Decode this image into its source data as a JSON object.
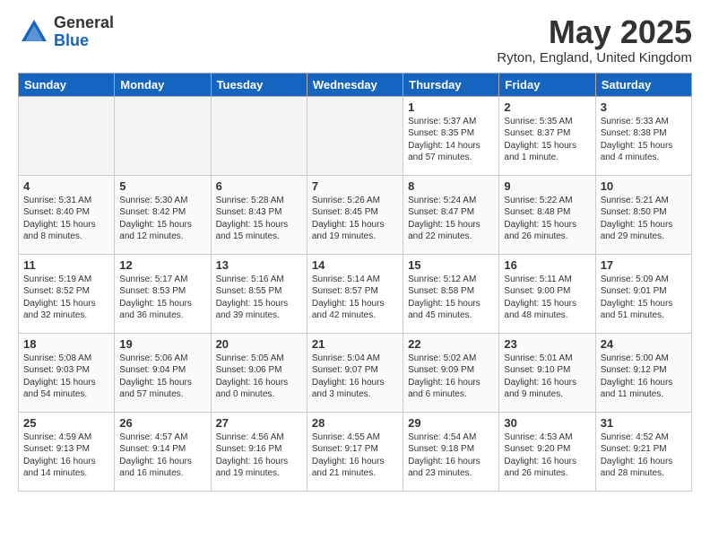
{
  "header": {
    "logo_general": "General",
    "logo_blue": "Blue",
    "month_title": "May 2025",
    "location": "Ryton, England, United Kingdom"
  },
  "weekdays": [
    "Sunday",
    "Monday",
    "Tuesday",
    "Wednesday",
    "Thursday",
    "Friday",
    "Saturday"
  ],
  "weeks": [
    [
      {
        "day": "",
        "info": ""
      },
      {
        "day": "",
        "info": ""
      },
      {
        "day": "",
        "info": ""
      },
      {
        "day": "",
        "info": ""
      },
      {
        "day": "1",
        "info": "Sunrise: 5:37 AM\nSunset: 8:35 PM\nDaylight: 14 hours\nand 57 minutes."
      },
      {
        "day": "2",
        "info": "Sunrise: 5:35 AM\nSunset: 8:37 PM\nDaylight: 15 hours\nand 1 minute."
      },
      {
        "day": "3",
        "info": "Sunrise: 5:33 AM\nSunset: 8:38 PM\nDaylight: 15 hours\nand 4 minutes."
      }
    ],
    [
      {
        "day": "4",
        "info": "Sunrise: 5:31 AM\nSunset: 8:40 PM\nDaylight: 15 hours\nand 8 minutes."
      },
      {
        "day": "5",
        "info": "Sunrise: 5:30 AM\nSunset: 8:42 PM\nDaylight: 15 hours\nand 12 minutes."
      },
      {
        "day": "6",
        "info": "Sunrise: 5:28 AM\nSunset: 8:43 PM\nDaylight: 15 hours\nand 15 minutes."
      },
      {
        "day": "7",
        "info": "Sunrise: 5:26 AM\nSunset: 8:45 PM\nDaylight: 15 hours\nand 19 minutes."
      },
      {
        "day": "8",
        "info": "Sunrise: 5:24 AM\nSunset: 8:47 PM\nDaylight: 15 hours\nand 22 minutes."
      },
      {
        "day": "9",
        "info": "Sunrise: 5:22 AM\nSunset: 8:48 PM\nDaylight: 15 hours\nand 26 minutes."
      },
      {
        "day": "10",
        "info": "Sunrise: 5:21 AM\nSunset: 8:50 PM\nDaylight: 15 hours\nand 29 minutes."
      }
    ],
    [
      {
        "day": "11",
        "info": "Sunrise: 5:19 AM\nSunset: 8:52 PM\nDaylight: 15 hours\nand 32 minutes."
      },
      {
        "day": "12",
        "info": "Sunrise: 5:17 AM\nSunset: 8:53 PM\nDaylight: 15 hours\nand 36 minutes."
      },
      {
        "day": "13",
        "info": "Sunrise: 5:16 AM\nSunset: 8:55 PM\nDaylight: 15 hours\nand 39 minutes."
      },
      {
        "day": "14",
        "info": "Sunrise: 5:14 AM\nSunset: 8:57 PM\nDaylight: 15 hours\nand 42 minutes."
      },
      {
        "day": "15",
        "info": "Sunrise: 5:12 AM\nSunset: 8:58 PM\nDaylight: 15 hours\nand 45 minutes."
      },
      {
        "day": "16",
        "info": "Sunrise: 5:11 AM\nSunset: 9:00 PM\nDaylight: 15 hours\nand 48 minutes."
      },
      {
        "day": "17",
        "info": "Sunrise: 5:09 AM\nSunset: 9:01 PM\nDaylight: 15 hours\nand 51 minutes."
      }
    ],
    [
      {
        "day": "18",
        "info": "Sunrise: 5:08 AM\nSunset: 9:03 PM\nDaylight: 15 hours\nand 54 minutes."
      },
      {
        "day": "19",
        "info": "Sunrise: 5:06 AM\nSunset: 9:04 PM\nDaylight: 15 hours\nand 57 minutes."
      },
      {
        "day": "20",
        "info": "Sunrise: 5:05 AM\nSunset: 9:06 PM\nDaylight: 16 hours\nand 0 minutes."
      },
      {
        "day": "21",
        "info": "Sunrise: 5:04 AM\nSunset: 9:07 PM\nDaylight: 16 hours\nand 3 minutes."
      },
      {
        "day": "22",
        "info": "Sunrise: 5:02 AM\nSunset: 9:09 PM\nDaylight: 16 hours\nand 6 minutes."
      },
      {
        "day": "23",
        "info": "Sunrise: 5:01 AM\nSunset: 9:10 PM\nDaylight: 16 hours\nand 9 minutes."
      },
      {
        "day": "24",
        "info": "Sunrise: 5:00 AM\nSunset: 9:12 PM\nDaylight: 16 hours\nand 11 minutes."
      }
    ],
    [
      {
        "day": "25",
        "info": "Sunrise: 4:59 AM\nSunset: 9:13 PM\nDaylight: 16 hours\nand 14 minutes."
      },
      {
        "day": "26",
        "info": "Sunrise: 4:57 AM\nSunset: 9:14 PM\nDaylight: 16 hours\nand 16 minutes."
      },
      {
        "day": "27",
        "info": "Sunrise: 4:56 AM\nSunset: 9:16 PM\nDaylight: 16 hours\nand 19 minutes."
      },
      {
        "day": "28",
        "info": "Sunrise: 4:55 AM\nSunset: 9:17 PM\nDaylight: 16 hours\nand 21 minutes."
      },
      {
        "day": "29",
        "info": "Sunrise: 4:54 AM\nSunset: 9:18 PM\nDaylight: 16 hours\nand 23 minutes."
      },
      {
        "day": "30",
        "info": "Sunrise: 4:53 AM\nSunset: 9:20 PM\nDaylight: 16 hours\nand 26 minutes."
      },
      {
        "day": "31",
        "info": "Sunrise: 4:52 AM\nSunset: 9:21 PM\nDaylight: 16 hours\nand 28 minutes."
      }
    ]
  ]
}
